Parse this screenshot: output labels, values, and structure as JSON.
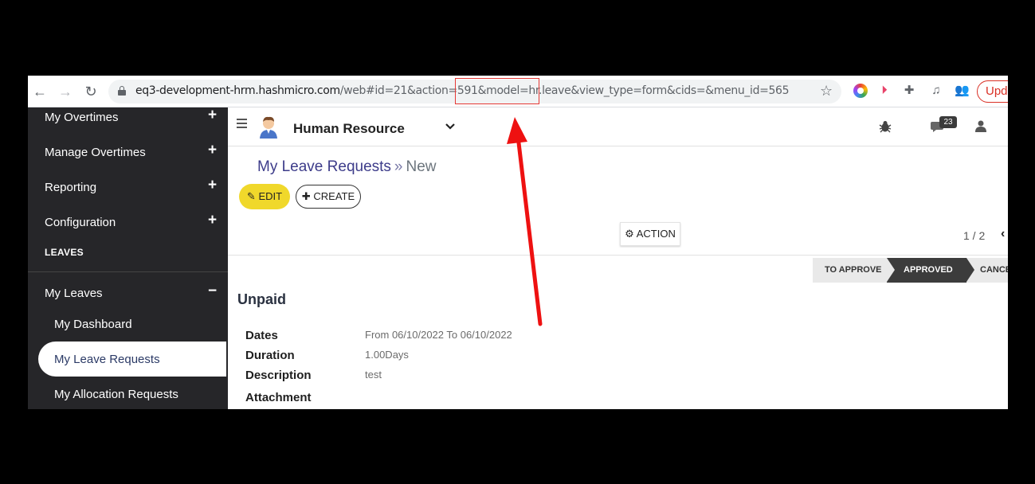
{
  "browser": {
    "url_host": "eq3-development-hrm.hashmicro.com",
    "url_path_before": "/web#id=21&action=591&",
    "url_highlight": "model=hr.leave",
    "url_path_after": "&view_type=form&cids=&menu_id=565",
    "update_label": "Upd",
    "highlight_color": "#e53935"
  },
  "sidebar": {
    "items": [
      {
        "label": "My Overtimes",
        "toggle": "+"
      },
      {
        "label": "Manage Overtimes",
        "toggle": "+"
      },
      {
        "label": "Reporting",
        "toggle": "+"
      },
      {
        "label": "Configuration",
        "toggle": "+"
      }
    ],
    "section_header": "LEAVES",
    "my_leaves": {
      "label": "My Leaves",
      "toggle": "−"
    },
    "sub_items": [
      {
        "label": "My Dashboard"
      },
      {
        "label": "My Leave Requests"
      },
      {
        "label": "My Allocation Requests"
      }
    ],
    "background_color": "#262629"
  },
  "topbar": {
    "app_title": "Human Resource",
    "chat_badge": "23"
  },
  "breadcrumb": {
    "parent": "My Leave Requests",
    "separator": "»",
    "current": "New"
  },
  "buttons": {
    "edit": "EDIT",
    "create": "CREATE",
    "action": "ACTION",
    "edit_color": "#f0d82b"
  },
  "pager": {
    "value": "1 / 2"
  },
  "status": {
    "stages": [
      "TO APPROVE",
      "APPROVED",
      "CANCEL"
    ],
    "active": "APPROVED"
  },
  "record": {
    "title": "Unpaid",
    "fields": [
      {
        "label": "Dates",
        "value": "From 06/10/2022 To 06/10/2022"
      },
      {
        "label": "Duration",
        "value": "1.00Days"
      },
      {
        "label": "Description",
        "value": "test"
      },
      {
        "label": "Attachment",
        "value": ""
      }
    ]
  },
  "annotation": {
    "arrow_color": "#ee1111"
  }
}
